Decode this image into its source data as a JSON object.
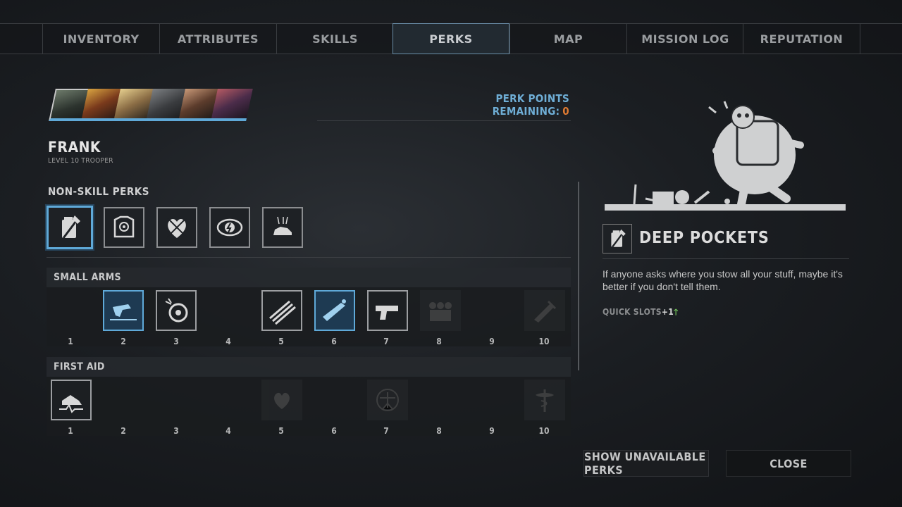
{
  "tabs": [
    {
      "label": "INVENTORY"
    },
    {
      "label": "ATTRIBUTES"
    },
    {
      "label": "SKILLS"
    },
    {
      "label": "PERKS"
    },
    {
      "label": "MAP"
    },
    {
      "label": "MISSION LOG"
    },
    {
      "label": "REPUTATION"
    }
  ],
  "active_tab": "PERKS",
  "perk_points": {
    "label": "PERK POINTS REMAINING:",
    "value": "0"
  },
  "character": {
    "name": "FRANK",
    "subtitle": "LEVEL 10 TROOPER"
  },
  "non_skill_perks": {
    "title": "NON-SKILL PERKS"
  },
  "skills": [
    {
      "name": "SMALL ARMS",
      "numbers": [
        "1",
        "2",
        "3",
        "4",
        "5",
        "6",
        "7",
        "8",
        "9",
        "10"
      ]
    },
    {
      "name": "FIRST AID",
      "numbers": [
        "1",
        "2",
        "3",
        "4",
        "5",
        "6",
        "7",
        "8",
        "9",
        "10"
      ]
    }
  ],
  "selected_perk": {
    "title": "DEEP POCKETS",
    "description": "If anyone asks where you stow all your stuff, maybe it's better if you don't tell them.",
    "bonus_label": "QUICK SLOTS",
    "bonus_value": "+1"
  },
  "buttons": {
    "show_unavailable": "SHOW UNAVAILABLE PERKS",
    "close": "CLOSE"
  },
  "colors": {
    "accent": "#5fa9d8",
    "points_value": "#e07b32",
    "bonus_arrow": "#6fbf5a"
  }
}
